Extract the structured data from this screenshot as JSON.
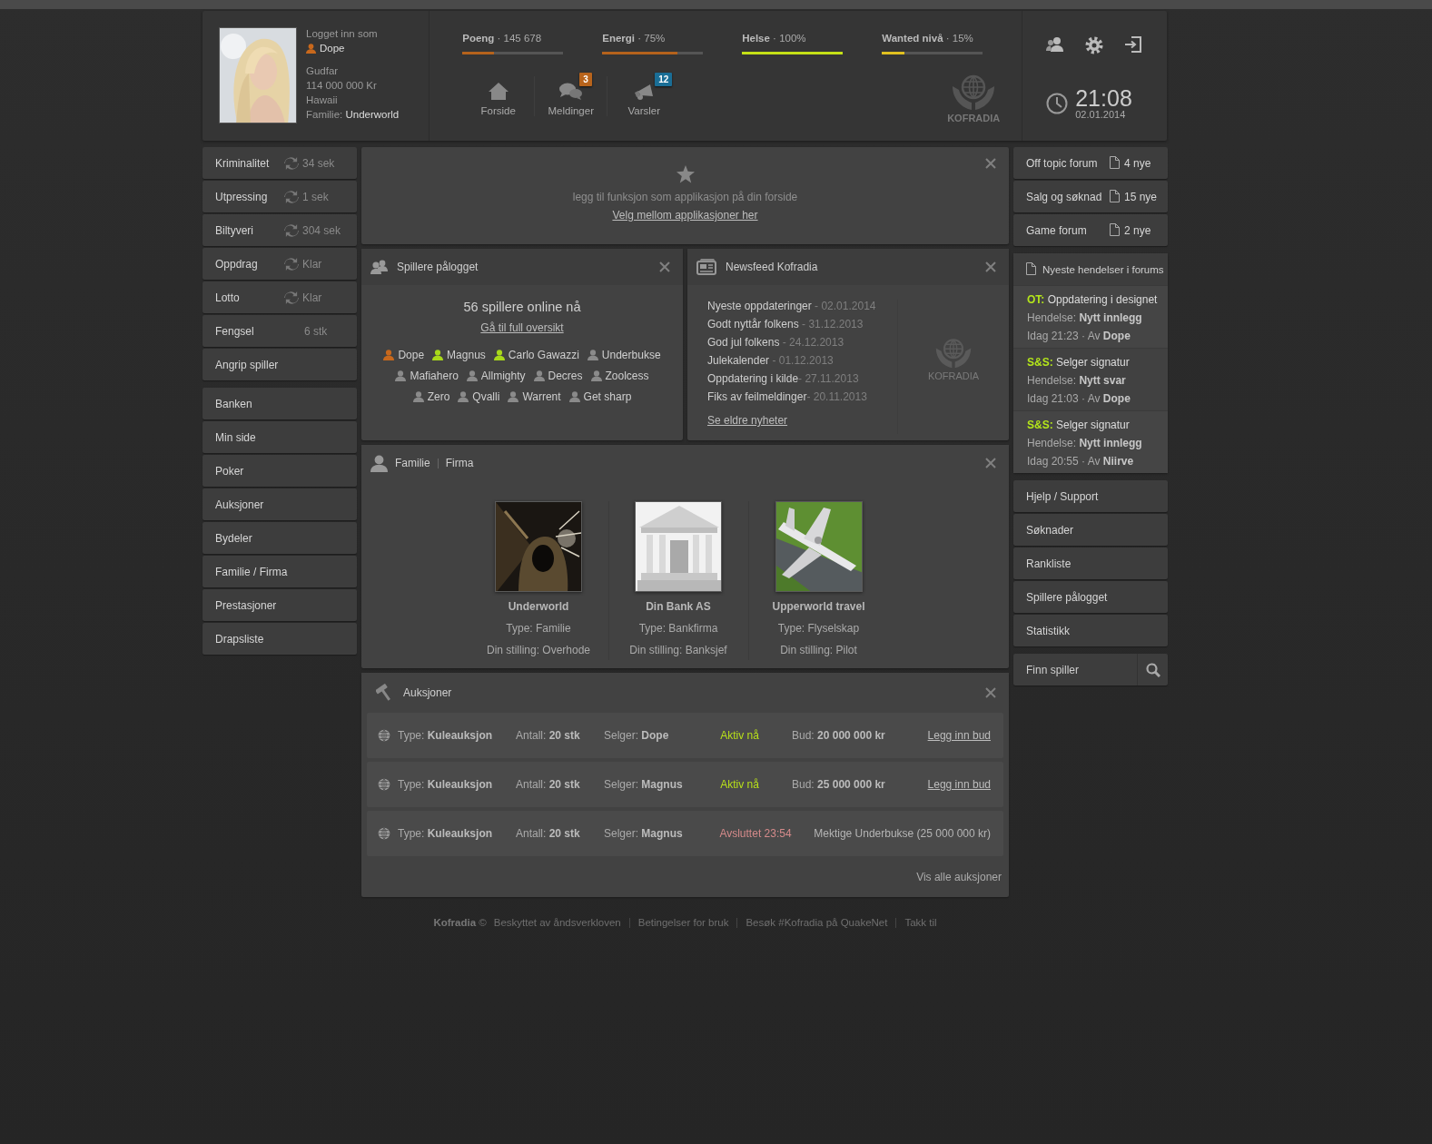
{
  "header": {
    "user": {
      "logged_in_label": "Logget inn som",
      "name": "Dope",
      "rank": "Gudfar",
      "money": "114 000 000 Kr",
      "location": "Hawaii",
      "family_label": "Familie:",
      "family": "Underworld"
    },
    "stats": [
      {
        "text": "**Poeng** · 145 678",
        "level": 0.31,
        "color": "#b5621c"
      },
      {
        "text": "**Energi** · 75%",
        "level": 0.75,
        "color": "#b5621c"
      },
      {
        "text": "**Helse** · 100%",
        "level": 1,
        "color": "#c5e017"
      },
      {
        "text": "**Wanted nivå** · 15%",
        "level": 0.22,
        "color": "#e0c020"
      }
    ],
    "nav": [
      {
        "kind": "home",
        "label": "Forside"
      },
      {
        "kind": "messages",
        "label": "Meldinger",
        "badge": "3",
        "color": "#b8641c"
      },
      {
        "kind": "alerts",
        "label": "Varsler",
        "badge": "12",
        "color": "#1a6e96"
      }
    ],
    "logo": "KOFRADIA",
    "clock": {
      "time": "21:08",
      "date": "02.01.2014"
    }
  },
  "left_menu": [
    {
      "items": [
        {
          "kind": "timer",
          "label": "Kriminalitet",
          "value": "34 sek"
        },
        {
          "kind": "timer",
          "label": "Utpressing",
          "value": "1 sek"
        },
        {
          "kind": "timer",
          "label": "Biltyveri",
          "value": "304 sek"
        },
        {
          "kind": "timer",
          "label": "Oppdrag",
          "value": "Klar"
        },
        {
          "kind": "timer",
          "label": "Lotto",
          "value": "Klar"
        },
        {
          "kind": "count",
          "label": "Fengsel",
          "value": "6 stk"
        },
        {
          "kind": "plain",
          "label": "Angrip spiller"
        }
      ]
    },
    {
      "items": [
        {
          "kind": "plain",
          "label": "Banken"
        },
        {
          "kind": "plain",
          "label": "Min side"
        },
        {
          "kind": "plain",
          "label": "Poker"
        },
        {
          "kind": "plain",
          "label": "Auksjoner"
        },
        {
          "kind": "plain",
          "label": "Bydeler"
        },
        {
          "kind": "plain",
          "label": "Familie / Firma"
        },
        {
          "kind": "plain",
          "label": "Prestasjoner"
        },
        {
          "kind": "plain",
          "label": "Drapsliste"
        }
      ]
    }
  ],
  "app_panel": {
    "text": "legg til funksjon som applikasjon på din forside",
    "link": "Velg mellom applikasjoner her"
  },
  "players_panel": {
    "title": "Spillere pålogget",
    "online": "56 spillere online nå",
    "link": "Gå til full oversikt",
    "players": [
      {
        "name": "Dope",
        "color": "#c8681c"
      },
      {
        "name": "Magnus",
        "color": "#a8d81a"
      },
      {
        "name": "Carlo Gawazzi",
        "color": "#a8d81a"
      },
      {
        "name": "Underbukse",
        "color": "#8a8a8a"
      },
      {
        "name": "Mafiahero",
        "color": "#8a8a8a"
      },
      {
        "name": "Allmighty",
        "color": "#8a8a8a"
      },
      {
        "name": "Decres",
        "color": "#8a8a8a"
      },
      {
        "name": "Zoolcess",
        "color": "#8a8a8a"
      },
      {
        "name": "Zero",
        "color": "#8a8a8a"
      },
      {
        "name": "Qvalli",
        "color": "#8a8a8a"
      },
      {
        "name": "Warrent",
        "color": "#8a8a8a"
      },
      {
        "name": "Get sharp",
        "color": "#8a8a8a"
      }
    ]
  },
  "newsfeed": {
    "title": "Newsfeed Kofradia",
    "items": [
      {
        "title": "Nyeste oppdateringer",
        "date": " - 02.01.2014"
      },
      {
        "title": "Godt nyttår folkens",
        "date": " - 31.12.2013"
      },
      {
        "title": "God jul folkens",
        "date": " - 24.12.2013"
      },
      {
        "title": "Julekalender",
        "date": " - 01.12.2013"
      },
      {
        "title": "Oppdatering i kilde",
        "date": "- 27.11.2013"
      },
      {
        "title": "Fiks av feilmeldinger",
        "date": "- 20.11.2013"
      }
    ],
    "link": "Se eldre nyheter",
    "logo": "KOFRADIA"
  },
  "family_panel": {
    "titles": [
      "Familie",
      "Firma"
    ],
    "cards": [
      {
        "name": "Underworld",
        "type": "Type: Familie",
        "position": "Din stilling: Overhode"
      },
      {
        "name": "Din Bank AS",
        "type": "Type: Bankfirma",
        "position": "Din stilling: Banksjef"
      },
      {
        "name": "Upperworld travel",
        "type": "Type: Flyselskap",
        "position": "Din stilling: Pilot"
      }
    ]
  },
  "auctions": {
    "title": "Auksjoner",
    "rows": [
      {
        "type": "Type: **Kuleauksjon**",
        "count": "Antall: **20 stk**",
        "seller": "Selger: **Dope**",
        "status": "Aktiv nå",
        "kind": "active",
        "bid": "Bud: **20 000 000 kr**",
        "action": "Legg inn bud"
      },
      {
        "type": "Type: **Kuleauksjon**",
        "count": "Antall: **20 stk**",
        "seller": "Selger: **Magnus**",
        "status": "Aktiv nå",
        "kind": "active",
        "bid": "Bud: **25 000 000 kr**",
        "action": "Legg inn bud"
      },
      {
        "type": "Type: **Kuleauksjon**",
        "count": "Antall: **20 stk**",
        "seller": "Selger: **Magnus**",
        "status": "Avsluttet 23:54",
        "kind": "ended",
        "result": "Mektige Underbukse (25 000 000 kr)"
      }
    ],
    "link": "Vis alle auksjoner"
  },
  "forums": [
    {
      "name": "Off topic forum",
      "count": "4 nye"
    },
    {
      "name": "Salg og søknad",
      "count": "15 nye"
    },
    {
      "name": "Game forum",
      "count": "2 nye"
    }
  ],
  "forum_events": {
    "title": "Nyeste hendelser i forums",
    "items": [
      {
        "tag": "OT:",
        "title": "Oppdatering i designet",
        "event": "Hendelse: **Nytt innlegg**",
        "meta": "Idag 21:23 · Av **Dope**"
      },
      {
        "tag": "S&S:",
        "title": "Selger signatur",
        "event": "Hendelse: **Nytt svar**",
        "meta": "Idag 21:03 · Av **Dope**"
      },
      {
        "tag": "S&S:",
        "title": "Selger signatur",
        "event": "Hendelse: **Nytt innlegg**",
        "meta": "Idag 20:55 · Av **Niirve**"
      }
    ]
  },
  "right_menu": [
    "Hjelp / Support",
    "Søknader",
    "Rankliste",
    "Spillere pålogget",
    "Statistikk"
  ],
  "search": {
    "placeholder": "Finn spiller"
  },
  "footer": {
    "brand": "**Kofradia** ©",
    "links": [
      "Beskyttet av åndsverkloven",
      "Betingelser for bruk",
      "Besøk #Kofradia på QuakeNet",
      "Takk til"
    ]
  }
}
